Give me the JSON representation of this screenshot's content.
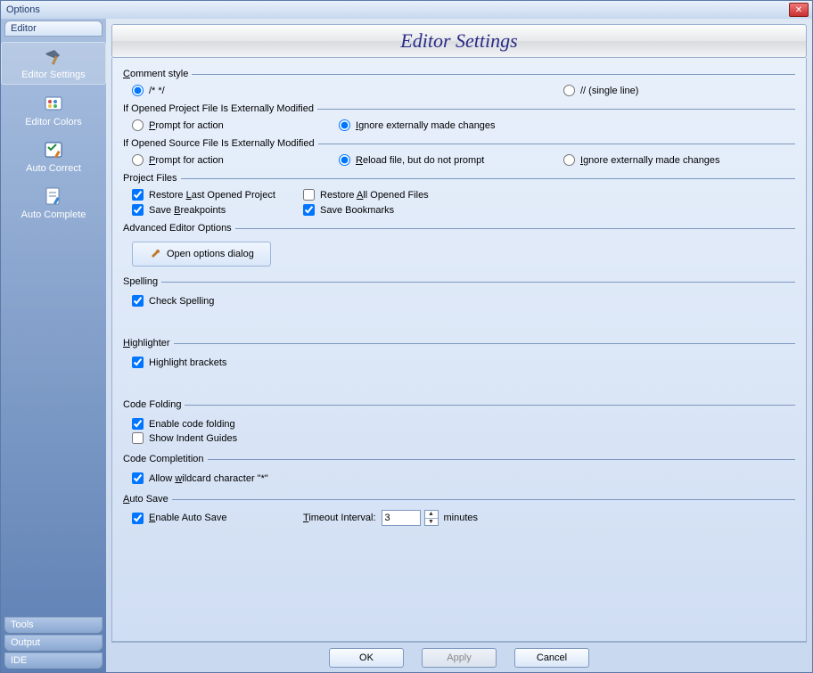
{
  "window": {
    "title": "Options"
  },
  "sidebar": {
    "tabs_top": [
      "Editor"
    ],
    "icons": [
      {
        "label": "Editor Settings"
      },
      {
        "label": "Editor Colors"
      },
      {
        "label": "Auto Correct"
      },
      {
        "label": "Auto Complete"
      }
    ],
    "tabs_bottom": [
      "Tools",
      "Output",
      "IDE"
    ]
  },
  "header": {
    "title": "Editor Settings"
  },
  "groups": {
    "comment": {
      "legend": "Comment style",
      "opt1": "/* */",
      "opt2": "// (single line)"
    },
    "project_modified": {
      "legend": "If Opened Project File Is Externally Modified",
      "opt1_u": "P",
      "opt1": "rompt for action",
      "opt2_u": "I",
      "opt2": "gnore externally made changes"
    },
    "source_modified": {
      "legend": "If Opened Source File Is Externally Modified",
      "opt1_u": "P",
      "opt1": "rompt for action",
      "opt2_u": "R",
      "opt2": "eload file, but do not prompt",
      "opt3_u": "I",
      "opt3": "gnore externally made changes"
    },
    "project_files": {
      "legend": "Project Files",
      "c1_pre": "Restore ",
      "c1_u": "L",
      "c1_post": "ast Opened Project",
      "c2_pre": "Restore ",
      "c2_u": "A",
      "c2_post": "ll Opened Files",
      "c3_pre": "Save ",
      "c3_u": "B",
      "c3_post": "reakpoints",
      "c4": "Save Bookmarks"
    },
    "advanced": {
      "legend": "Advanced Editor Options",
      "btn": "Open options dialog"
    },
    "spelling": {
      "legend": "Spelling",
      "c1": "Check Spelling"
    },
    "highlighter": {
      "legend_u": "H",
      "legend": "ighlighter",
      "c1": "Highlight brackets"
    },
    "folding": {
      "legend": "Code Folding",
      "c1": "Enable code folding",
      "c2": "Show Indent Guides"
    },
    "completion": {
      "legend": "Code Completition",
      "c1_pre": "Allow ",
      "c1_u": "w",
      "c1_post": "ildcard character \"*\""
    },
    "autosave": {
      "legend_u": "A",
      "legend": "uto Save",
      "c1_u": "E",
      "c1": "nable Auto Save",
      "label_u": "T",
      "label": "imeout Interval:",
      "value": "3",
      "unit": "minutes"
    }
  },
  "footer": {
    "ok": "OK",
    "apply": "Apply",
    "cancel": "Cancel"
  }
}
